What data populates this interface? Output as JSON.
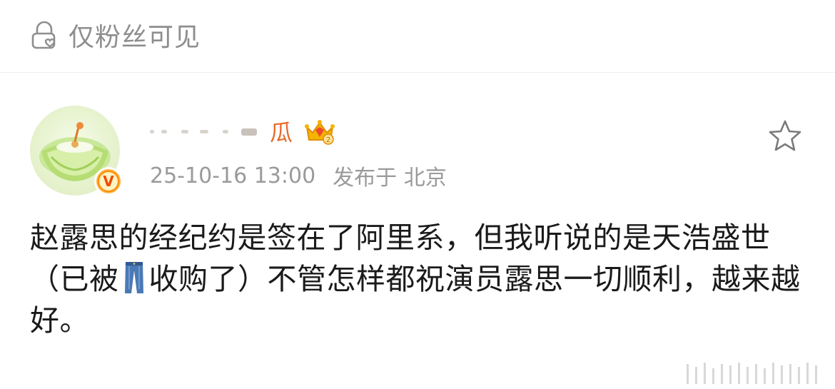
{
  "visibility": {
    "icon": "lock-heart-icon",
    "label": "仅粉丝可见"
  },
  "post": {
    "author": {
      "name_visible": "瓜",
      "avatar": "melon-avatar",
      "verified_badge": "V",
      "level_icon": "crown-icon-level-2"
    },
    "timestamp": "25-10-16 13:00",
    "location": "发布于 北京",
    "body": {
      "part1": "赵露思的经纪约是签在了阿里系，但我听说的是天浩盛世（已被",
      "emoji": "jeans-icon",
      "part2": "收购了）不管怎样都祝演员露思一切顺利，越来越好。"
    },
    "favorite_icon": "star-outline-icon"
  },
  "colors": {
    "username": "#e86b2b",
    "meta": "#9a9a9a",
    "body": "#1a1a1a",
    "visibility_text": "#8e8e8e"
  }
}
